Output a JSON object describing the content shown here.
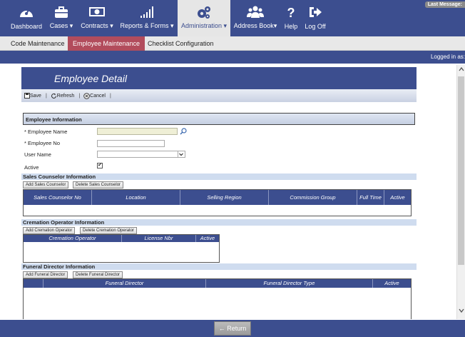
{
  "nav": {
    "items": [
      {
        "label": "Dashboard",
        "icon": "dashboard-icon"
      },
      {
        "label": "Cases",
        "caret": "▾",
        "icon": "briefcase-icon"
      },
      {
        "label": "Contracts",
        "caret": "▾",
        "icon": "money-icon"
      },
      {
        "label": "Reports & Forms",
        "caret": "▾",
        "icon": "bar-chart-icon"
      },
      {
        "label": "Administration",
        "caret": "▾",
        "icon": "gears-icon"
      },
      {
        "label": "Address Book",
        "caret": "▾",
        "icon": "users-icon"
      },
      {
        "label": "Help",
        "icon": "help-icon"
      },
      {
        "label": "Log Off",
        "icon": "logoff-icon"
      }
    ],
    "last_message": "Last Message:"
  },
  "subnav": {
    "items": [
      "Code Maintenance",
      "Employee Maintenance",
      "Checklist Configuration"
    ]
  },
  "status": {
    "logged_in": "Logged in as:"
  },
  "page": {
    "title": "Employee Detail"
  },
  "toolbar": {
    "save": "Save",
    "refresh": "Refresh",
    "cancel": "Cancel",
    "sep": "|"
  },
  "employee_info": {
    "header": "Employee Information",
    "name_label": "* Employee Name",
    "number_label": "* Employee No",
    "username_label": "User Name",
    "active_label": "Active",
    "active_checked": "✔"
  },
  "sales": {
    "header": "Sales Counselor Information",
    "add_button": "Add Sales Counselor",
    "delete_button": "Delete Sales Counselor",
    "columns": [
      "Sales Counselor No",
      "Location",
      "Selling Region",
      "Commission Group",
      "Full Time",
      "Active"
    ]
  },
  "cremation": {
    "header": "Cremation Operator Information",
    "add_button": "Add Cremation Operator",
    "delete_button": "Delete Cremation Operator",
    "columns": [
      "Cremation Operator",
      "License Nbr",
      "Active"
    ]
  },
  "funeral": {
    "header": "Funeral Director Information",
    "add_button": "Add Funeral Director",
    "delete_button": "Delete Funeral Director",
    "columns": [
      "Funeral Director",
      "Funeral Director Type",
      "Active"
    ]
  },
  "footer": {
    "return_label": "Return",
    "return_arrow": "←"
  },
  "colors": {
    "nav_bg": "#3c4e8f",
    "active_subnav": "#b24c5c",
    "grid_header": "#3c4e8f",
    "section_header": "#cfdcef"
  }
}
